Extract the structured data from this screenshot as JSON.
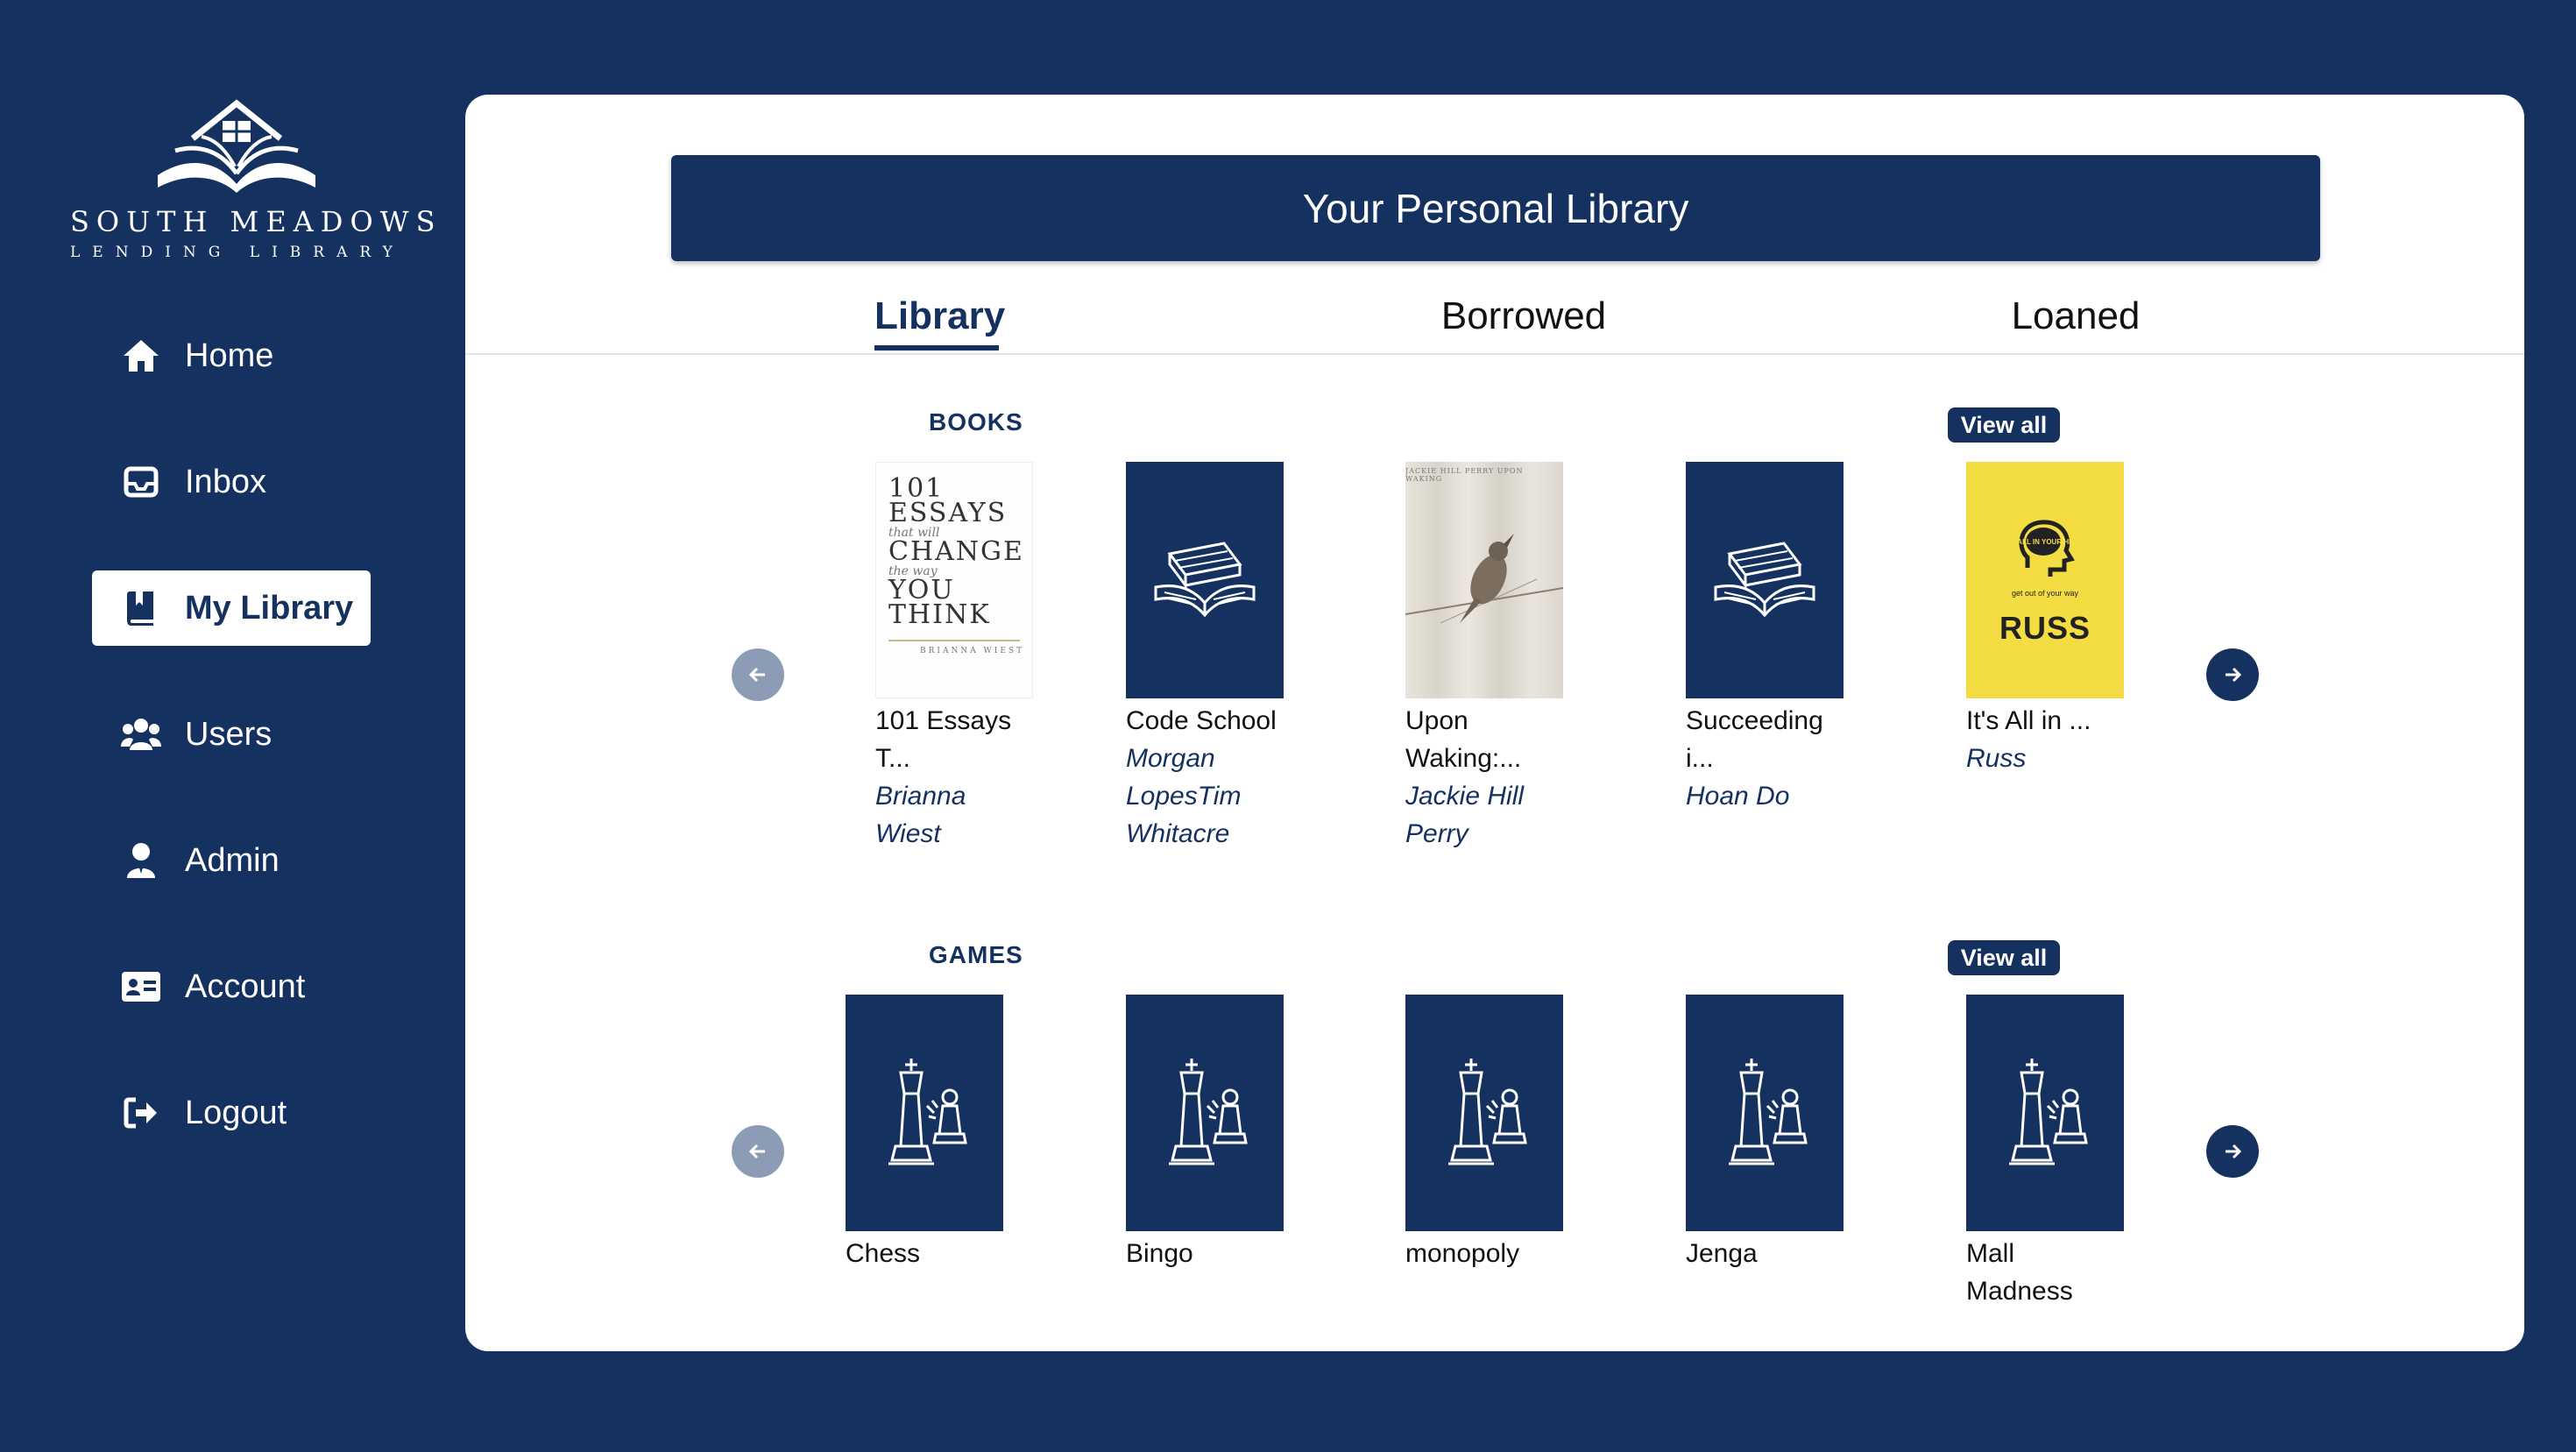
{
  "brand": {
    "name": "SOUTH MEADOWS",
    "tagline": "LENDING LIBRARY",
    "logo_icon": "house-book-icon"
  },
  "nav": [
    {
      "label": "Home",
      "icon": "home-icon",
      "active": false
    },
    {
      "label": "Inbox",
      "icon": "inbox-icon",
      "active": false
    },
    {
      "label": "My Library",
      "icon": "book-icon",
      "active": true
    },
    {
      "label": "Users",
      "icon": "users-icon",
      "active": false
    },
    {
      "label": "Admin",
      "icon": "admin-icon",
      "active": false
    },
    {
      "label": "Account",
      "icon": "id-card-icon",
      "active": false
    },
    {
      "label": "Logout",
      "icon": "logout-icon",
      "active": false
    }
  ],
  "page": {
    "banner_title": "Your Personal Library",
    "tabs": [
      {
        "label": "Library",
        "active": true
      },
      {
        "label": "Borrowed",
        "active": false
      },
      {
        "label": "Loaned",
        "active": false
      }
    ]
  },
  "books": {
    "section_label": "BOOKS",
    "view_all_label": "View all",
    "items": [
      {
        "title_lines": [
          "101 Essays",
          "T..."
        ],
        "author_lines": [
          "Brianna",
          "Wiest"
        ],
        "cover": "essays-cover",
        "cover_text": {
          "line1": "101",
          "line2": "ESSAYS",
          "line3": "that will",
          "line4": "CHANGE",
          "line5": "the way",
          "line6": "YOU",
          "line7": "THINK",
          "author": "BRIANNA WIEST"
        }
      },
      {
        "title_lines": [
          "Code School"
        ],
        "author_lines": [
          "Morgan",
          "LopesTim",
          "Whitacre"
        ],
        "cover": "placeholder-book-icon"
      },
      {
        "title_lines": [
          "Upon",
          "Waking:..."
        ],
        "author_lines": [
          "Jackie Hill",
          "Perry"
        ],
        "cover": "bird-cover",
        "cover_text": {
          "header": "JACKIE HILL PERRY   UPON WAKING"
        }
      },
      {
        "title_lines": [
          "Succeeding",
          "i..."
        ],
        "author_lines": [
          "Hoan Do"
        ],
        "cover": "placeholder-book-icon"
      },
      {
        "title_lines": [
          "It's All in ..."
        ],
        "author_lines": [
          "Russ"
        ],
        "cover": "russ-cover",
        "cover_text": {
          "head": "IT'S ALL IN YOUR HEAD",
          "tag": "get out of your way",
          "name": "RUSS"
        }
      }
    ]
  },
  "games": {
    "section_label": "GAMES",
    "view_all_label": "View all",
    "items": [
      {
        "title_lines": [
          "Chess"
        ],
        "cover": "chess-pieces-icon"
      },
      {
        "title_lines": [
          "Bingo"
        ],
        "cover": "chess-pieces-icon"
      },
      {
        "title_lines": [
          "monopoly"
        ],
        "cover": "chess-pieces-icon"
      },
      {
        "title_lines": [
          "Jenga"
        ],
        "cover": "chess-pieces-icon"
      },
      {
        "title_lines": [
          "Mall",
          "Madness"
        ],
        "cover": "chess-pieces-icon"
      }
    ]
  },
  "colors": {
    "primary": "#14315f",
    "panel": "#ffffff",
    "arrow_disabled": "#8d9cb5",
    "russ_yellow": "#f4dd42"
  }
}
